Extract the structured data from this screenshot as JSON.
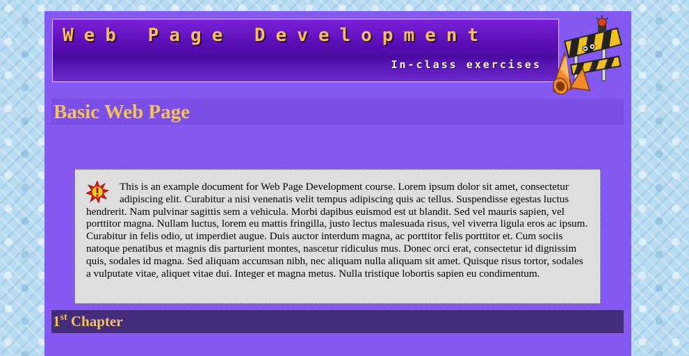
{
  "banner": {
    "title": "Web Page Development",
    "subtitle": "In-class exercises"
  },
  "icons": {
    "construction": "construction-barrier-icon",
    "notice": "exclamation-burst-icon"
  },
  "main": {
    "title": "Basic Web Page",
    "notice_text": "This is an example document for Web Page Development course. Lorem ipsum dolor sit amet, consectetur adipiscing elit. Curabitur a nisi venenatis velit tempus adipiscing quis ac tellus. Suspendisse egestas luctus hendrerit. Nam pulvinar sagittis sem a vehicula. Morbi dapibus euismod est ut blandit. Sed vel mauris sapien, vel porttitor magna. Nullam luctus, lorem eu mattis fringilla, justo lectus malesuada risus, vel viverra ligula eros ac ipsum. Curabitur in felis odio, ut imperdiet augue. Duis auctor interdum magna, ac porttitor felis porttitor et. Cum sociis natoque penatibus et magnis dis parturient montes, nascetur ridiculus mus. Donec orci erat, consectetur id dignissim quis, sodales id magna. Sed aliquam accumsan nibh, nec aliquam nulla aliquam sit amet. Quisque risus tortor, sodales a vulputate vitae, aliquet vitae dui. Integer et magna metus. Nulla tristique lobortis sapien eu condimentum.",
    "chapter": {
      "number": "1",
      "suffix": "st",
      "label": "Chapter"
    }
  },
  "colors": {
    "page": "#8359f2",
    "heading_bar": "#7b4ee8",
    "heading_text": "#f5c257",
    "chapter_bar": "#432c7a",
    "notice_bg": "#dedede"
  }
}
